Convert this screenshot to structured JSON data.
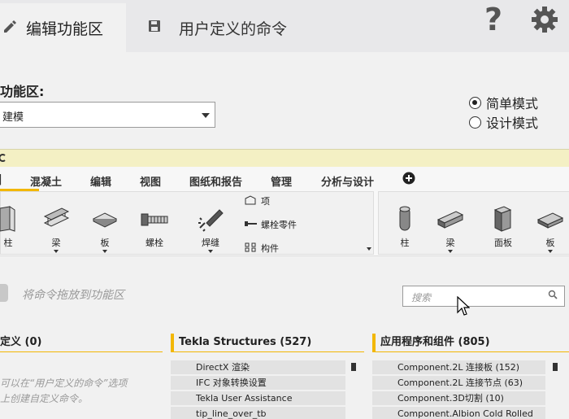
{
  "tabs": {
    "active": "编辑功能区",
    "inactive": "用户定义的命令"
  },
  "top_icons": [
    "help-icon",
    "settings-gear-icon"
  ],
  "ribbon_area": {
    "label": "功能区:",
    "selected": "建模"
  },
  "mode": {
    "options": [
      "简单模式",
      "设计模式"
    ],
    "selected": "简单模式"
  },
  "ribbon_tabs": [
    "混凝土",
    "编辑",
    "视图",
    "图纸和报告",
    "管理",
    "分析与设计"
  ],
  "ribbon_left_tools": [
    "柱",
    "梁",
    "板",
    "螺栓",
    "焊缝"
  ],
  "ribbon_stack": [
    "项",
    "螺栓零件",
    "构件"
  ],
  "ribbon_right_tools": [
    "柱",
    "梁",
    "面板",
    "板"
  ],
  "drag_hint": "将命令拖放到功能区",
  "search": {
    "placeholder": "搜索"
  },
  "columns": {
    "user": "定义 (0)",
    "tekla": "Tekla Structures (527)",
    "apps": "应用程序和组件 (805)"
  },
  "user_hint": [
    "可以在“用户定义的命令”选项",
    "上创建自定义命令。"
  ],
  "tekla_items": [
    "DirectX 渲染",
    "IFC 对象转换设置",
    "Tekla User Assistance",
    "tip_line_over_tb"
  ],
  "app_items": [
    "Component.2L 连接板 (152)",
    "Component.2L 连接节点 (63)",
    "Component.3D切割 (10)",
    "Component.Albion Cold Rolled"
  ],
  "colors": {
    "accent": "#f2b705",
    "strip": "#f4f0c4"
  }
}
